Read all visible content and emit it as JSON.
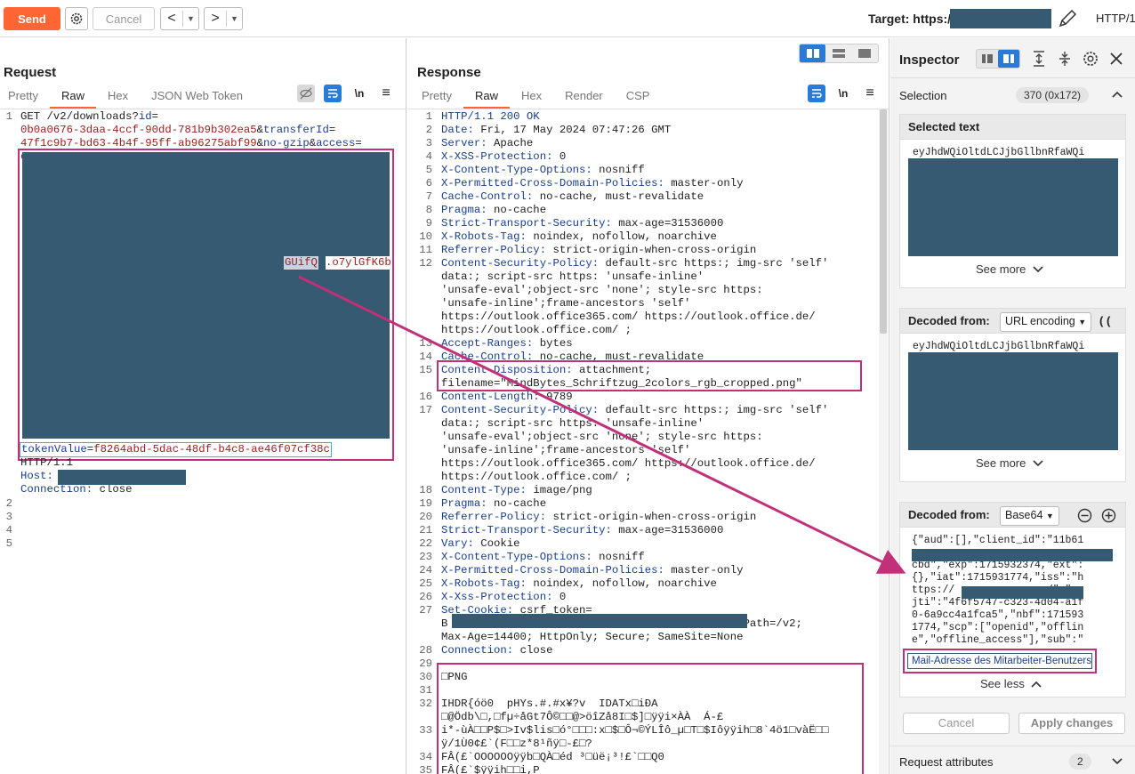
{
  "toolbar": {
    "send_label": "Send",
    "cancel_label": "Cancel",
    "back_arrow": "<",
    "forward_arrow": ">",
    "target_label": "Target: https://",
    "http_version": "HTTP/1"
  },
  "request": {
    "title": "Request",
    "tabs": [
      "Pretty",
      "Raw",
      "Hex",
      "JSON Web Token"
    ],
    "active_tab": "Raw",
    "newline_toggle": "\\n",
    "lines": {
      "l1a": "GET /v2/downloads?",
      "l1b": "id",
      "l1c": "=",
      "l1d": "0b0a0676-3daa-4ccf-90dd-781b9b302ea5",
      "l1e": "&",
      "l1f": "transferId",
      "l1g": "=",
      "l1h": "47f1c9b7-bd63-4b4f-95ff-ab96275abf99",
      "l1i": "&",
      "l1j": "no-gzip",
      "l1k": "&",
      "l1l": "access",
      "l1m": "=",
      "token_start": "ey",
      "selected_frag": "GUifQ",
      "after_sel": ".o7ylGfK6b",
      "token_value_key": "tokenValue",
      "token_value_eq": "=",
      "token_value": "f8264abd-5dac-48df-b4c8-ae46f07cf38c",
      "http_ver": "HTTP/1.1",
      "host_key": "Host:",
      "conn_key": "Connection:",
      "conn_val": " close"
    },
    "line_numbers": [
      "1",
      "",
      "",
      "",
      "",
      "",
      "",
      "",
      "",
      "",
      "",
      "",
      "",
      "",
      "",
      "",
      "",
      "",
      "",
      "",
      "",
      "",
      "",
      "",
      "",
      "",
      "2",
      "3",
      "4",
      "5"
    ]
  },
  "response": {
    "title": "Response",
    "tabs": [
      "Pretty",
      "Raw",
      "Hex",
      "Render",
      "CSP"
    ],
    "active_tab": "Raw",
    "newline_toggle": "\\n",
    "rows": [
      {
        "n": "1",
        "k": "HTTP/1.1 200 OK",
        "v": ""
      },
      {
        "n": "2",
        "k": "Date:",
        "v": " Fri, 17 May 2024 07:47:26 GMT"
      },
      {
        "n": "3",
        "k": "Server:",
        "v": " Apache"
      },
      {
        "n": "4",
        "k": "X-XSS-Protection:",
        "v": " 0"
      },
      {
        "n": "5",
        "k": "X-Content-Type-Options:",
        "v": " nosniff"
      },
      {
        "n": "6",
        "k": "X-Permitted-Cross-Domain-Policies:",
        "v": " master-only"
      },
      {
        "n": "7",
        "k": "Cache-Control:",
        "v": " no-cache, must-revalidate"
      },
      {
        "n": "8",
        "k": "Pragma:",
        "v": " no-cache"
      },
      {
        "n": "9",
        "k": "Strict-Transport-Security:",
        "v": " max-age=31536000"
      },
      {
        "n": "10",
        "k": "X-Robots-Tag:",
        "v": " noindex, nofollow, noarchive"
      },
      {
        "n": "11",
        "k": "Referrer-Policy:",
        "v": " strict-origin-when-cross-origin"
      },
      {
        "n": "12",
        "k": "Content-Security-Policy:",
        "v": " default-src https:; img-src 'self'"
      },
      {
        "n": "",
        "k": "",
        "v": "data:; script-src https: 'unsafe-inline'"
      },
      {
        "n": "",
        "k": "",
        "v": "'unsafe-eval';object-src 'none'; style-src https:"
      },
      {
        "n": "",
        "k": "",
        "v": "'unsafe-inline';frame-ancestors 'self'"
      },
      {
        "n": "",
        "k": "",
        "v": "https://outlook.office365.com/ https://outlook.office.de/"
      },
      {
        "n": "",
        "k": "",
        "v": "https://outlook.office.com/ ;"
      },
      {
        "n": "13",
        "k": "Accept-Ranges:",
        "v": " bytes"
      },
      {
        "n": "14",
        "k": "Cache-Control:",
        "v": " no-cache, must-revalidate"
      },
      {
        "n": "15",
        "k": "Content-Disposition:",
        "v": " attachment;"
      },
      {
        "n": "",
        "k": "",
        "v": "filename=\"MindBytes_Schriftzug_2colors_rgb_cropped.png\""
      },
      {
        "n": "16",
        "k": "Content-Length:",
        "v": " 9789"
      },
      {
        "n": "17",
        "k": "Content-Security-Policy:",
        "v": " default-src https:; img-src 'self'"
      },
      {
        "n": "",
        "k": "",
        "v": "data:; script-src https: 'unsafe-inline'"
      },
      {
        "n": "",
        "k": "",
        "v": "'unsafe-eval';object-src 'none'; style-src https:"
      },
      {
        "n": "",
        "k": "",
        "v": "'unsafe-inline';frame-ancestors 'self'"
      },
      {
        "n": "",
        "k": "",
        "v": "https://outlook.office365.com/ https://outlook.office.de/"
      },
      {
        "n": "",
        "k": "",
        "v": "https://outlook.office.com/ ;"
      },
      {
        "n": "18",
        "k": "Content-Type:",
        "v": " image/png"
      },
      {
        "n": "19",
        "k": "Pragma:",
        "v": " no-cache"
      },
      {
        "n": "20",
        "k": "Referrer-Policy:",
        "v": " strict-origin-when-cross-origin"
      },
      {
        "n": "21",
        "k": "Strict-Transport-Security:",
        "v": " max-age=31536000"
      },
      {
        "n": "22",
        "k": "Vary:",
        "v": " Cookie"
      },
      {
        "n": "23",
        "k": "X-Content-Type-Options:",
        "v": " nosniff"
      },
      {
        "n": "24",
        "k": "X-Permitted-Cross-Domain-Policies:",
        "v": " master-only"
      },
      {
        "n": "25",
        "k": "X-Robots-Tag:",
        "v": " noindex, nofollow, noarchive"
      },
      {
        "n": "26",
        "k": "X-Xss-Protection:",
        "v": " 0"
      },
      {
        "n": "27",
        "k": "Set-Cookie:",
        "v": " csrf_token="
      },
      {
        "n": "",
        "k": "",
        "v": "B                                           ; Path=/v2;"
      },
      {
        "n": "",
        "k": "",
        "v": "Max-Age=14400; HttpOnly; Secure; SameSite=None"
      },
      {
        "n": "28",
        "k": "Connection:",
        "v": " close"
      },
      {
        "n": "29",
        "k": "",
        "v": ""
      },
      {
        "n": "30",
        "k": "",
        "v": "□PNG"
      },
      {
        "n": "31",
        "k": "",
        "v": ""
      },
      {
        "n": "32",
        "k": "",
        "v": "IHDR{óö0  pHYs.#.#x¥?v  IDATx□iÐA"
      },
      {
        "n": "",
        "k": "",
        "v": "□@Ödb\\□,□fµ÷åGt7Ô©□□@>öîZå8I□$]□ÿÿi×ÀÀ  Á-£"
      },
      {
        "n": "33",
        "k": "",
        "v": "i*-ùÀ□□P$□>Iv$lis□ó°□□□:x□$□Ô¬©ÝLÎô_µ□T□$Iôÿÿih□8`4ö1□vàË□□"
      },
      {
        "n": "",
        "k": "",
        "v": "ÿ/1Ù0¢£`(F□□z*8¹ñÿ□-£□?"
      },
      {
        "n": "34",
        "k": "",
        "v": "FÂ(£`OOOOOOÿÿb□QÀ□éd ³□üë¡³!£`□□Q0"
      },
      {
        "n": "35",
        "k": "",
        "v": "FÂ(£`$ÿÿih□□i,P"
      }
    ]
  },
  "inspector": {
    "title": "Inspector",
    "selection_label": "Selection",
    "selection_badge": "370 (0x172)",
    "selected_text_title": "Selected text",
    "selected_text_preview": "eyJhdWQiOltdLCJjbGllbnRfaWQi",
    "see_more": "See more",
    "decoded_url_title": "Decoded from:",
    "decoded_url_select": "URL encoding",
    "decoded_url_preview": "eyJhdWQiOltdLCJjbGllbnRfaWQi",
    "see_more_2": "See more",
    "decoded_b64_title": "Decoded from:",
    "decoded_b64_select": "Base64",
    "json_lines": {
      "l1": "{\"aud\":[],\"client_id\":\"11b61",
      "l3": "cbd\",\"exp\":1715932374,\"ext\":",
      "l4": "{},\"iat\":1715931774,\"iss\":\"h",
      "l5a": "ttps://",
      "l5b": "/\",\"",
      "l6": "jti\":\"4f6f5747-c323-4d04-a1f",
      "l7": "0-6a9cc4a1fca5\",\"nbf\":171593",
      "l8": "1774,\"scp\":[\"openid\",\"offlin",
      "l9": "e\",\"offline_access\"],\"sub\":\""
    },
    "annotation": "Mail-Adresse des Mitarbeiter-Benutzers",
    "see_less": "See less",
    "cancel_label": "Cancel",
    "apply_label": "Apply changes",
    "request_attributes_label": "Request attributes",
    "request_attributes_badge": "2"
  },
  "colors": {
    "accent": "#ff6633",
    "redaction": "#375a73",
    "annotation": "#c2307a",
    "key": "#1a3e8c",
    "value": "#9a1c1c"
  }
}
